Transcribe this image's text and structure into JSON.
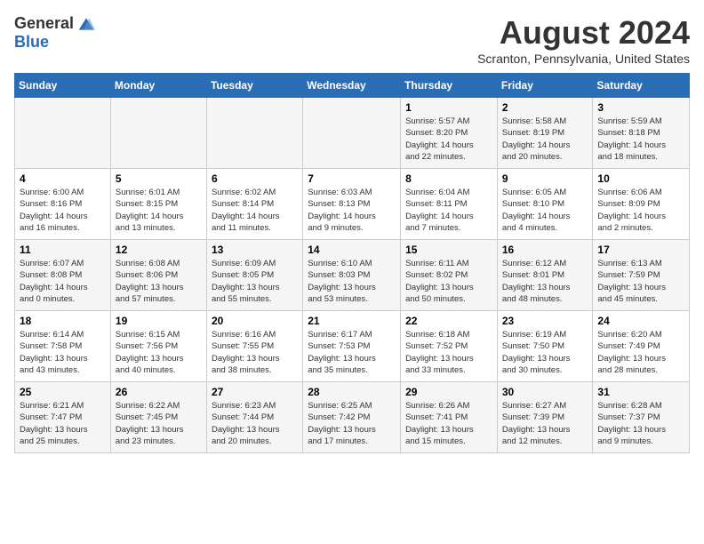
{
  "header": {
    "logo_general": "General",
    "logo_blue": "Blue",
    "month_year": "August 2024",
    "location": "Scranton, Pennsylvania, United States"
  },
  "weekdays": [
    "Sunday",
    "Monday",
    "Tuesday",
    "Wednesday",
    "Thursday",
    "Friday",
    "Saturday"
  ],
  "weeks": [
    [
      {
        "day": "",
        "info": ""
      },
      {
        "day": "",
        "info": ""
      },
      {
        "day": "",
        "info": ""
      },
      {
        "day": "",
        "info": ""
      },
      {
        "day": "1",
        "info": "Sunrise: 5:57 AM\nSunset: 8:20 PM\nDaylight: 14 hours\nand 22 minutes."
      },
      {
        "day": "2",
        "info": "Sunrise: 5:58 AM\nSunset: 8:19 PM\nDaylight: 14 hours\nand 20 minutes."
      },
      {
        "day": "3",
        "info": "Sunrise: 5:59 AM\nSunset: 8:18 PM\nDaylight: 14 hours\nand 18 minutes."
      }
    ],
    [
      {
        "day": "4",
        "info": "Sunrise: 6:00 AM\nSunset: 8:16 PM\nDaylight: 14 hours\nand 16 minutes."
      },
      {
        "day": "5",
        "info": "Sunrise: 6:01 AM\nSunset: 8:15 PM\nDaylight: 14 hours\nand 13 minutes."
      },
      {
        "day": "6",
        "info": "Sunrise: 6:02 AM\nSunset: 8:14 PM\nDaylight: 14 hours\nand 11 minutes."
      },
      {
        "day": "7",
        "info": "Sunrise: 6:03 AM\nSunset: 8:13 PM\nDaylight: 14 hours\nand 9 minutes."
      },
      {
        "day": "8",
        "info": "Sunrise: 6:04 AM\nSunset: 8:11 PM\nDaylight: 14 hours\nand 7 minutes."
      },
      {
        "day": "9",
        "info": "Sunrise: 6:05 AM\nSunset: 8:10 PM\nDaylight: 14 hours\nand 4 minutes."
      },
      {
        "day": "10",
        "info": "Sunrise: 6:06 AM\nSunset: 8:09 PM\nDaylight: 14 hours\nand 2 minutes."
      }
    ],
    [
      {
        "day": "11",
        "info": "Sunrise: 6:07 AM\nSunset: 8:08 PM\nDaylight: 14 hours\nand 0 minutes."
      },
      {
        "day": "12",
        "info": "Sunrise: 6:08 AM\nSunset: 8:06 PM\nDaylight: 13 hours\nand 57 minutes."
      },
      {
        "day": "13",
        "info": "Sunrise: 6:09 AM\nSunset: 8:05 PM\nDaylight: 13 hours\nand 55 minutes."
      },
      {
        "day": "14",
        "info": "Sunrise: 6:10 AM\nSunset: 8:03 PM\nDaylight: 13 hours\nand 53 minutes."
      },
      {
        "day": "15",
        "info": "Sunrise: 6:11 AM\nSunset: 8:02 PM\nDaylight: 13 hours\nand 50 minutes."
      },
      {
        "day": "16",
        "info": "Sunrise: 6:12 AM\nSunset: 8:01 PM\nDaylight: 13 hours\nand 48 minutes."
      },
      {
        "day": "17",
        "info": "Sunrise: 6:13 AM\nSunset: 7:59 PM\nDaylight: 13 hours\nand 45 minutes."
      }
    ],
    [
      {
        "day": "18",
        "info": "Sunrise: 6:14 AM\nSunset: 7:58 PM\nDaylight: 13 hours\nand 43 minutes."
      },
      {
        "day": "19",
        "info": "Sunrise: 6:15 AM\nSunset: 7:56 PM\nDaylight: 13 hours\nand 40 minutes."
      },
      {
        "day": "20",
        "info": "Sunrise: 6:16 AM\nSunset: 7:55 PM\nDaylight: 13 hours\nand 38 minutes."
      },
      {
        "day": "21",
        "info": "Sunrise: 6:17 AM\nSunset: 7:53 PM\nDaylight: 13 hours\nand 35 minutes."
      },
      {
        "day": "22",
        "info": "Sunrise: 6:18 AM\nSunset: 7:52 PM\nDaylight: 13 hours\nand 33 minutes."
      },
      {
        "day": "23",
        "info": "Sunrise: 6:19 AM\nSunset: 7:50 PM\nDaylight: 13 hours\nand 30 minutes."
      },
      {
        "day": "24",
        "info": "Sunrise: 6:20 AM\nSunset: 7:49 PM\nDaylight: 13 hours\nand 28 minutes."
      }
    ],
    [
      {
        "day": "25",
        "info": "Sunrise: 6:21 AM\nSunset: 7:47 PM\nDaylight: 13 hours\nand 25 minutes."
      },
      {
        "day": "26",
        "info": "Sunrise: 6:22 AM\nSunset: 7:45 PM\nDaylight: 13 hours\nand 23 minutes."
      },
      {
        "day": "27",
        "info": "Sunrise: 6:23 AM\nSunset: 7:44 PM\nDaylight: 13 hours\nand 20 minutes."
      },
      {
        "day": "28",
        "info": "Sunrise: 6:25 AM\nSunset: 7:42 PM\nDaylight: 13 hours\nand 17 minutes."
      },
      {
        "day": "29",
        "info": "Sunrise: 6:26 AM\nSunset: 7:41 PM\nDaylight: 13 hours\nand 15 minutes."
      },
      {
        "day": "30",
        "info": "Sunrise: 6:27 AM\nSunset: 7:39 PM\nDaylight: 13 hours\nand 12 minutes."
      },
      {
        "day": "31",
        "info": "Sunrise: 6:28 AM\nSunset: 7:37 PM\nDaylight: 13 hours\nand 9 minutes."
      }
    ]
  ]
}
